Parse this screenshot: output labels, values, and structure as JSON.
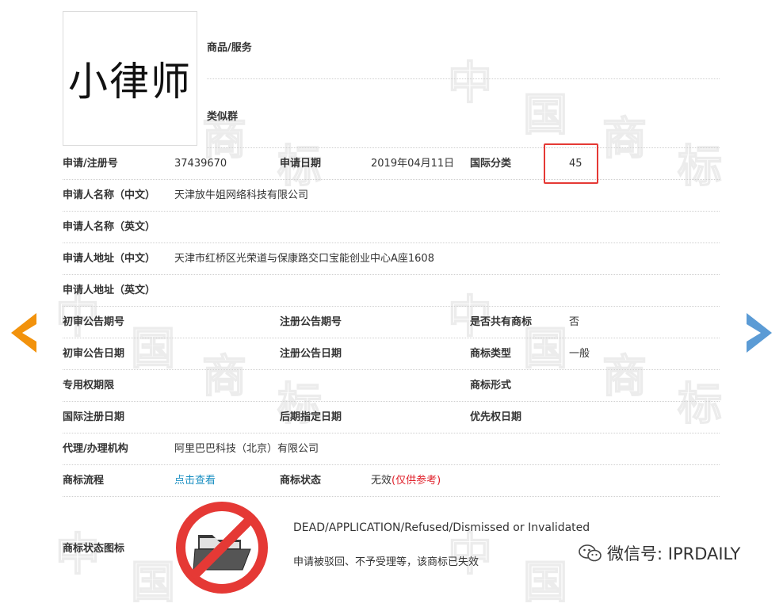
{
  "trademark": {
    "name": "小律师"
  },
  "top_labels": {
    "goods_services": "商品/服务",
    "similar_group": "类似群"
  },
  "rows": {
    "reg_no_label": "申请/注册号",
    "reg_no_value": "37439670",
    "app_date_label": "申请日期",
    "app_date_value": "2019年04月11日",
    "intl_class_label": "国际分类",
    "intl_class_value": "45",
    "applicant_cn_label": "申请人名称（中文）",
    "applicant_cn_value": "天津放牛姐网络科技有限公司",
    "applicant_en_label": "申请人名称（英文）",
    "address_cn_label": "申请人地址（中文）",
    "address_cn_value": "天津市红桥区光荣道与保康路交口宝能创业中心A座1608",
    "address_en_label": "申请人地址（英文）",
    "prelim_issue_label": "初审公告期号",
    "reg_issue_label": "注册公告期号",
    "shared_label": "是否共有商标",
    "shared_value": "否",
    "prelim_date_label": "初审公告日期",
    "reg_date_label": "注册公告日期",
    "type_label": "商标类型",
    "type_value": "一般",
    "exclusive_label": "专用权期限",
    "form_label": "商标形式",
    "intl_reg_label": "国际注册日期",
    "later_designation_label": "后期指定日期",
    "priority_label": "优先权日期",
    "agent_label": "代理/办理机构",
    "agent_value": "阿里巴巴科技（北京）有限公司",
    "process_label": "商标流程",
    "process_link": "点击查看",
    "status_label": "商标状态",
    "status_value": "无效",
    "status_note": "(仅供参考)",
    "status_icon_label": "商标状态图标"
  },
  "status": {
    "en": "DEAD/APPLICATION/Refused/Dismissed or Invalidated",
    "cn": "申请被驳回、不予受理等，该商标已失效"
  },
  "watermark": {
    "char1": "中",
    "char2": "国",
    "char3": "商",
    "char4": "标"
  },
  "wechat": {
    "text": "微信号: IPRDAILY"
  },
  "colors": {
    "accent": "#f2920c",
    "nav_right": "#5b9bd5",
    "link": "#1a8fc2",
    "alert": "#e53935"
  }
}
